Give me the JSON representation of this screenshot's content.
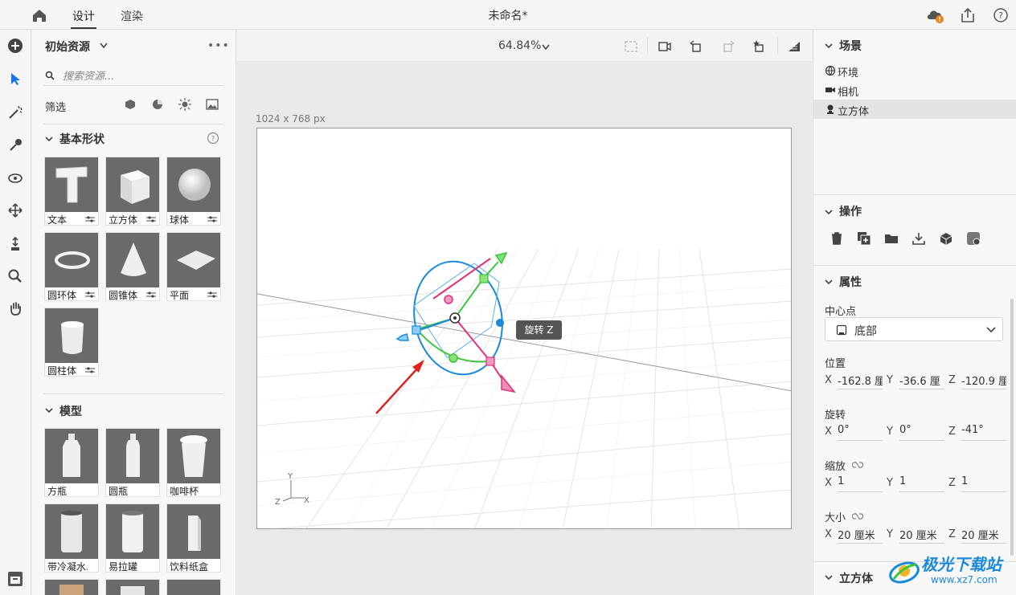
{
  "topbar": {
    "tab_design": "设计",
    "tab_render": "渲染",
    "title": "未命名*"
  },
  "assets": {
    "header": "初始资源",
    "search_placeholder": "搜索资源...",
    "filter_label": "筛选",
    "basic_section": "基本形状",
    "basic_items": [
      "文本",
      "立方体",
      "球体",
      "圆环体",
      "圆锥体",
      "平面",
      "圆柱体"
    ],
    "model_section": "模型",
    "model_items": [
      "方瓶",
      "圆瓶",
      "咖啡杯",
      "带冷凝水...",
      "易拉罐",
      "饮料纸盒"
    ]
  },
  "workspace": {
    "zoom": "64.84%",
    "canvas_size": "1024 x 768 px",
    "tooltip": "旋转 Z",
    "axis_y": "Y",
    "axis_z": "Z",
    "axis_x": "X"
  },
  "right": {
    "scene_title": "场景",
    "scene_items": [
      "环境",
      "相机",
      "立方体"
    ],
    "ops_title": "操作",
    "props_title": "属性",
    "pivot_label": "中心点",
    "pivot_value": "底部",
    "position_label": "位置",
    "position": {
      "x": "-162.8 厘",
      "y": "-36.6 厘",
      "z": "-120.9 厘"
    },
    "rotation_label": "旋转",
    "rotation": {
      "x": "0°",
      "y": "0°",
      "z": "-41°"
    },
    "scale_label": "缩放",
    "scale": {
      "x": "1",
      "y": "1",
      "z": "1"
    },
    "size_label": "大小",
    "size": {
      "x": "20 厘米",
      "y": "20 厘米",
      "z": "20 厘米"
    },
    "cube_section": "立方体",
    "axis_x": "X",
    "axis_y": "Y",
    "axis_z": "Z"
  },
  "watermark": {
    "line1": "极光下载站",
    "line2": "www.xz7.com"
  },
  "colors": {
    "gizmo_blue": "#1a8ad8",
    "gizmo_green": "#3cc43c",
    "gizmo_pink": "#e0337a",
    "selection": "#1473e6"
  }
}
